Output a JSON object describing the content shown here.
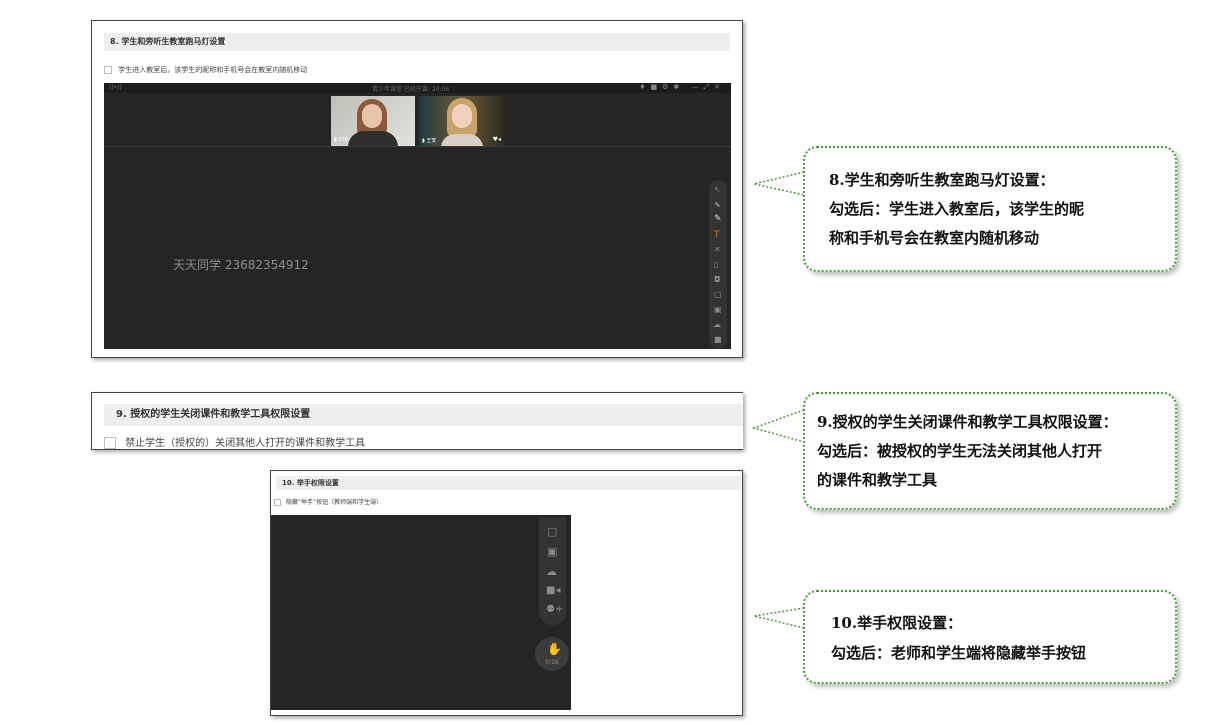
{
  "panel1": {
    "section_title": "8. 学生和旁听生教室跑马灯设置",
    "checkbox_label": "学生进入教室后，该学生的昵称和手机号会在教室内随机移动",
    "classroom": {
      "top_bar_text": "青少年课堂  已经开课: 20:06",
      "video_tiles": [
        {
          "name": "618"
        },
        {
          "name": "王安"
        }
      ],
      "marquee_text": "天天同学 23682354912"
    }
  },
  "panel2": {
    "section_title": "9. 授权的学生关闭课件和教学工具权限设置",
    "checkbox_label": "禁止学生（授权的）关闭其他人打开的课件和教学工具"
  },
  "panel3": {
    "section_title": "10. 举手权限设置",
    "checkbox_label": "隐藏“举手”按钮（教师端和学生端）",
    "hand_count": "0/16"
  },
  "callouts": [
    {
      "lines": [
        "8.学生和旁听生教室跑马灯设置：",
        "勾选后：学生进入教室后，该学生的昵",
        "称和手机号会在教室内随机移动"
      ]
    },
    {
      "lines": [
        "9.授权的学生关闭课件和教学工具权限设置：",
        "勾选后：被授权的学生无法关闭其他人打开",
        "的课件和教学工具"
      ]
    },
    {
      "lines": [
        "10.举手权限设置：",
        "勾选后：老师和学生端将隐藏举手按钮"
      ]
    }
  ],
  "colors": {
    "callout_border": "#4a9a3c",
    "classroom_bg": "#252525",
    "section_head_bg": "#eeeeee"
  }
}
